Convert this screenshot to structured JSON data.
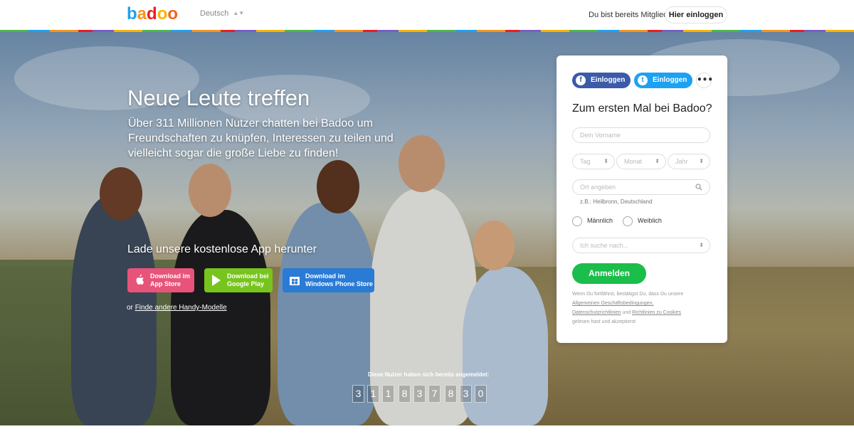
{
  "header": {
    "logo_text": "badoo",
    "language": "Deutsch",
    "member_question": "Du bist bereits Mitglied?",
    "login_button": "Hier einloggen"
  },
  "hero": {
    "headline": "Neue Leute treffen",
    "subline": "Über 311 Millionen Nutzer chatten bei Badoo um Freundschaften zu knüpfen, Interessen zu teilen und vielleicht sogar die große Liebe zu finden!",
    "app_title": "Lade unsere kostenlose App herunter",
    "stores": {
      "apple_line1": "Download im",
      "apple_line2": "App Store",
      "google_line1": "Download bei",
      "google_line2": "Google Play",
      "windows_line1": "Download im",
      "windows_line2": "Windows Phone Store"
    },
    "other_prefix": "or",
    "other_link": "Finde andere Handy-Modelle",
    "counter_label": "Diese Nutzer haben sich bereits angemeldet:",
    "counter_digits": [
      "3",
      "1",
      "1",
      "8",
      "3",
      "7",
      "8",
      "3",
      "0"
    ]
  },
  "form": {
    "facebook_label": "Einloggen",
    "twitter_label": "Einloggen",
    "more_label": "•••",
    "title": "Zum ersten Mal bei Badoo?",
    "name_placeholder": "Dein Vorname",
    "day_label": "Tag",
    "month_label": "Monat",
    "year_label": "Jahr",
    "location_placeholder": "Ort angeben",
    "location_hint": "z.B.: Heilbronn, Deutschland",
    "male_label": "Männlich",
    "female_label": "Weiblich",
    "seek_label": "Ich suche nach...",
    "submit_label": "Anmelden",
    "legal_prefix": "Wenn Du fortfährst, bestätigst Du, dass Du unsere",
    "legal_link1": "Allgemeinen Geschäftsbedingungen,",
    "legal_link2": "Datenschutzrichtlinien",
    "legal_and": "und",
    "legal_link3": "Richtlinien zu Cookies",
    "legal_suffix": "gelesen hast und akzeptierst"
  },
  "colors": {
    "facebook": "#3b5ba9",
    "twitter": "#1da1f2",
    "submit": "#1bbd4b",
    "apple_btn": "#e8537a",
    "google_btn": "#78c41e",
    "windows_btn": "#2a7bd6"
  }
}
